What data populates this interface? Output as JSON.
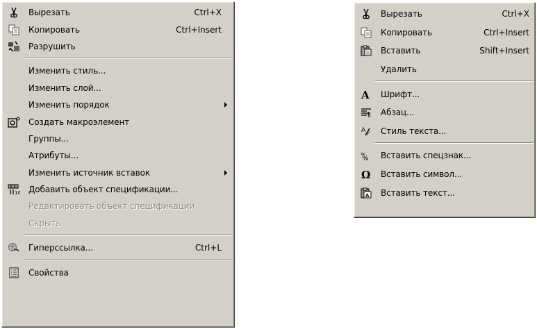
{
  "left_menu": {
    "items": [
      {
        "label": "Вырезать",
        "shortcut": "Ctrl+X",
        "icon": "scissors-icon"
      },
      {
        "label": "Копировать",
        "shortcut": "Ctrl+Insert",
        "icon": "copy-icon"
      },
      {
        "label": "Разрушить",
        "icon": "explode-icon"
      },
      {
        "label": "Изменить стиль..."
      },
      {
        "label": "Изменить слой..."
      },
      {
        "label": "Изменить порядок",
        "submenu": true
      },
      {
        "label": "Создать макроэлемент",
        "icon": "macro-icon"
      },
      {
        "label": "Группы..."
      },
      {
        "label": "Атрибуты..."
      },
      {
        "label": "Изменить источник вставок",
        "submenu": true
      },
      {
        "label": "Добавить объект спецификации...",
        "icon": "specification-icon"
      },
      {
        "label": "Редактировать объект спецификации",
        "disabled": true
      },
      {
        "label": "Скрыть",
        "disabled": true
      },
      {
        "label": "Гиперссылка...",
        "shortcut": "Ctrl+L",
        "icon": "hyperlink-icon"
      },
      {
        "label": "Свойства",
        "icon": "properties-icon"
      }
    ]
  },
  "right_menu": {
    "items": [
      {
        "label": "Вырезать",
        "shortcut": "Ctrl+X",
        "icon": "scissors-icon"
      },
      {
        "label": "Копировать",
        "shortcut": "Ctrl+Insert",
        "icon": "copy-icon"
      },
      {
        "label": "Вставить",
        "shortcut": "Shift+Insert",
        "icon": "paste-icon"
      },
      {
        "label": "Удалить"
      },
      {
        "label": "Шрифт...",
        "icon": "font-icon"
      },
      {
        "label": "Абзац...",
        "icon": "paragraph-icon"
      },
      {
        "label": "Стиль текста...",
        "icon": "text-style-icon"
      },
      {
        "label": "Вставить спецзнак...",
        "icon": "special-char-icon"
      },
      {
        "label": "Вставить символ...",
        "icon": "omega-icon"
      },
      {
        "label": "Вставить текст...",
        "icon": "insert-text-icon"
      }
    ]
  },
  "colors": {
    "menu_bg": "#d4d0c8",
    "disabled_text": "#8f8d88"
  }
}
